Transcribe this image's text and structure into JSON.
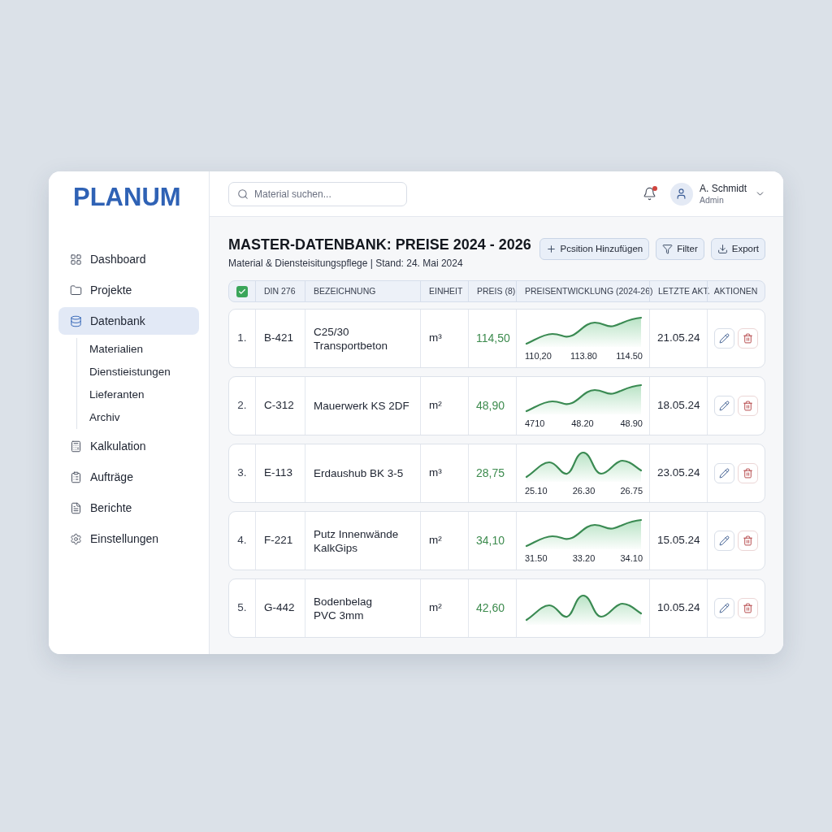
{
  "sidebar": {
    "logo": "PLANUM",
    "nav": [
      {
        "label": "Dashboard",
        "selected": false
      },
      {
        "label": "Projekte",
        "selected": false
      },
      {
        "label": "Datenbank",
        "selected": true,
        "expanded": true,
        "children": [
          {
            "label": "Materialien",
            "selected": false
          },
          {
            "label": "Dienstieistungen",
            "selected": false
          },
          {
            "label": "Lieferanten",
            "selected": false
          },
          {
            "label": "Archiv",
            "selected": false
          }
        ]
      },
      {
        "label": "Kalkulation",
        "selected": false
      },
      {
        "label": "Aufträge",
        "selected": false
      },
      {
        "label": "Berichte",
        "selected": false
      },
      {
        "label": "Einstellungen",
        "selected": false
      }
    ]
  },
  "header": {
    "search": {
      "placeholder": "Material suchen..."
    },
    "notifications": {
      "unread": true
    },
    "user": {
      "name": "A. Schmidt",
      "role": "Admin"
    }
  },
  "page": {
    "title": "MASTER-DATENBANK: PREISE 2024 - 2026",
    "subtitle": "Material & Diensteisitungspflege | Stand: 24. Mai 2024",
    "actions": [
      {
        "kind": "add",
        "label": "Pcsition Hinzufügen"
      },
      {
        "kind": "filter",
        "label": "Filter"
      },
      {
        "kind": "export",
        "label": "Export"
      }
    ]
  },
  "table": {
    "select_all": {
      "checked": true
    },
    "columns": [
      "DIN 276",
      "BEZEICHNUNG",
      "EINHEIT",
      "PREIS (8)",
      "PREISENTWICKLUNG (2024-26)",
      "LETZTE AKT.",
      "AKTIONEN"
    ],
    "rows": [
      {
        "number": "1.",
        "din": "B-421",
        "name": "C25/30\nTransportbeton",
        "unit": "m³",
        "price": "114,50",
        "trend": {
          "kind": "rising",
          "labels": [
            "110,20",
            "113.80",
            "114.50"
          ]
        },
        "updated": "21.05.24"
      },
      {
        "number": "2.",
        "din": "C-312",
        "name": "Mauerwerk KS 2DF",
        "unit": "m²",
        "price": "48,90",
        "trend": {
          "kind": "rising",
          "labels": [
            "4710",
            "48.20",
            "48.90"
          ]
        },
        "updated": "18.05.24"
      },
      {
        "number": "3.",
        "din": "E-113",
        "name": "Erdaushub BK 3-5",
        "unit": "m³",
        "price": "28,75",
        "trend": {
          "kind": "wavy",
          "labels": [
            "25.10",
            "26.30",
            "26.75"
          ]
        },
        "updated": "23.05.24"
      },
      {
        "number": "4.",
        "din": "F-221",
        "name": "Putz Innenwände\nKalkGips",
        "unit": "m²",
        "price": "34,10",
        "trend": {
          "kind": "rising",
          "labels": [
            "31.50",
            "33.20",
            "34.10"
          ]
        },
        "updated": "15.05.24"
      },
      {
        "number": "5.",
        "din": "G-442",
        "name": "Bodenbelag\nPVC 3mm",
        "unit": "m²",
        "price": "42,60",
        "trend": {
          "kind": "wavy"
        },
        "updated": "10.05.24"
      }
    ]
  }
}
